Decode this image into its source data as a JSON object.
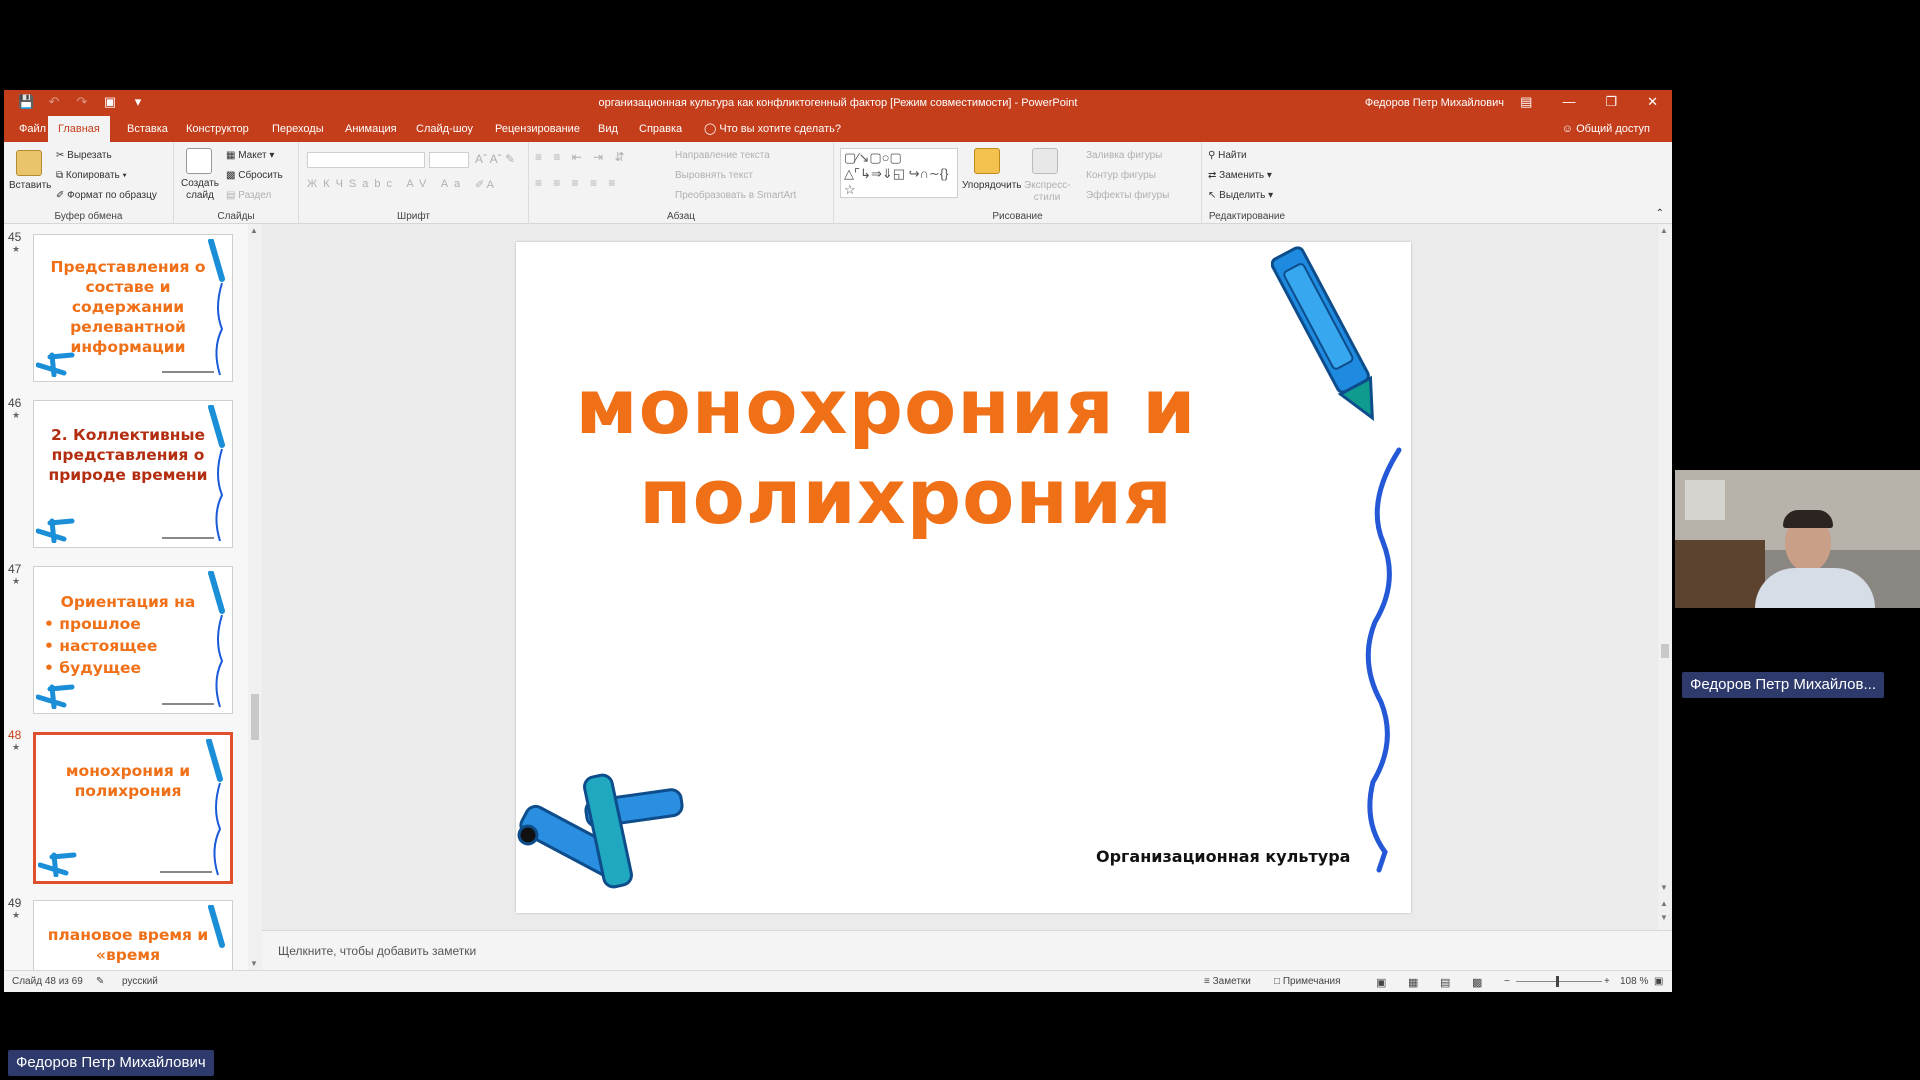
{
  "window": {
    "title": "организационная культура как конфликтогенный фактор [Режим совместимости]  -  PowerPoint",
    "user": "Федоров Петр Михайлович"
  },
  "tabs": [
    "Файл",
    "Главная",
    "Вставка",
    "Конструктор",
    "Переходы",
    "Анимация",
    "Слайд-шоу",
    "Рецензирование",
    "Вид",
    "Справка"
  ],
  "tell_me": "Что вы хотите сделать?",
  "share_label": "Общий доступ",
  "ribbon": {
    "clipboard": {
      "paste": "Вставить",
      "cut": "Вырезать",
      "copy": "Копировать",
      "format_painter": "Формат по образцу",
      "label": "Буфер обмена"
    },
    "slides": {
      "new_slide": "Создать слайд",
      "layout": "Макет",
      "reset": "Сбросить",
      "section": "Раздел",
      "label": "Слайды"
    },
    "font": {
      "label": "Шрифт"
    },
    "paragraph": {
      "text_direction": "Направление текста",
      "align_text": "Выровнять текст",
      "smartart": "Преобразовать в SmartArt",
      "label": "Абзац"
    },
    "drawing": {
      "arrange": "Упорядочить",
      "quick_styles": "Экспресс-стили",
      "fill": "Заливка фигуры",
      "outline": "Контур фигуры",
      "effects": "Эффекты фигуры",
      "label": "Рисование"
    },
    "editing": {
      "find": "Найти",
      "replace": "Заменить",
      "select": "Выделить",
      "label": "Редактирование"
    }
  },
  "thumbnails": [
    {
      "num": "45",
      "text": "Представления о составе и содержании релевантной информации",
      "color": "#f07018"
    },
    {
      "num": "46",
      "text": "2. Коллективные представления о природе времени",
      "color": "#b32e10"
    },
    {
      "num": "47",
      "lines": [
        "Ориентация на",
        "• прошлое",
        "• настоящее",
        "• будущее"
      ],
      "color": "#f07018"
    },
    {
      "num": "48",
      "text": "монохрония и полихрония",
      "color": "#f07018"
    },
    {
      "num": "49",
      "text": "плановое время и «время",
      "color": "#f07018"
    }
  ],
  "slide": {
    "title_line1": "монохрония и",
    "title_line2": "полихрония",
    "footer": "Организационная культура",
    "title_color": "#f07018"
  },
  "notes_placeholder": "Щелкните, чтобы добавить заметки",
  "status": {
    "slide_info": "Слайд 48 из 69",
    "language": "русский",
    "notes": "Заметки",
    "comments": "Примечания",
    "zoom": "108 %"
  },
  "webcam_name": "Федоров Петр Михайлов...",
  "presenter_name": "Федоров Петр Михайлович",
  "colors": {
    "accent": "#c43e1c",
    "slide_title": "#f07018",
    "name_tag": "#2d3a6b"
  }
}
